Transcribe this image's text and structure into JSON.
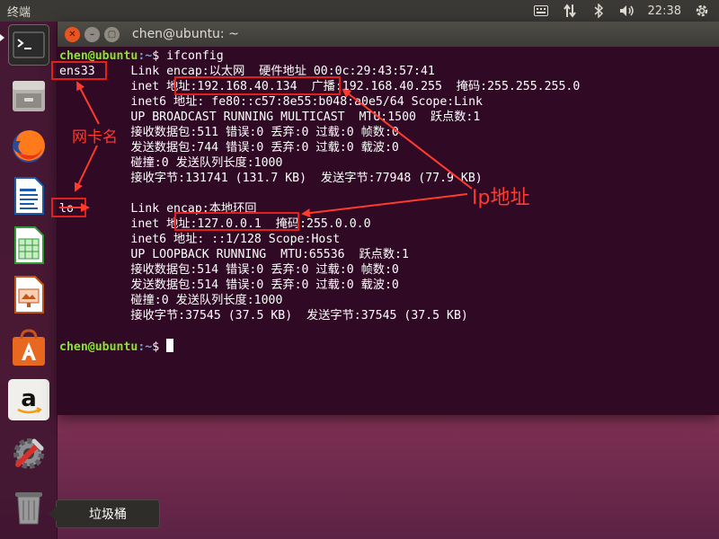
{
  "top_panel": {
    "app_title": "终端",
    "clock": "22:38",
    "tray_icons": [
      "keyboard-icon",
      "network-icon",
      "bluetooth-icon",
      "volume-icon",
      "gear-icon"
    ]
  },
  "launcher": {
    "items": [
      {
        "name": "terminal",
        "icon": "terminal-icon"
      },
      {
        "name": "files",
        "icon": "files-icon"
      },
      {
        "name": "firefox",
        "icon": "firefox-icon"
      },
      {
        "name": "writer",
        "icon": "writer-icon"
      },
      {
        "name": "calc",
        "icon": "calc-icon"
      },
      {
        "name": "impress",
        "icon": "impress-icon"
      },
      {
        "name": "software",
        "icon": "software-icon"
      },
      {
        "name": "amazon",
        "icon": "amazon-icon"
      },
      {
        "name": "settings",
        "icon": "settings-icon"
      },
      {
        "name": "trash",
        "icon": "trash-icon"
      }
    ],
    "tooltip": "垃圾桶"
  },
  "terminal": {
    "title": "chen@ubuntu: ~",
    "prompt_user": "chen@ubuntu",
    "prompt_path": ":~",
    "prompt_symbol": "$ ",
    "command": "ifconfig",
    "lines": [
      "ens33     Link encap:以太网  硬件地址 00:0c:29:43:57:41  ",
      "          inet 地址:192.168.40.134  广播:192.168.40.255  掩码:255.255.255.0",
      "          inet6 地址: fe80::c57:8e55:b048:a0e5/64 Scope:Link",
      "          UP BROADCAST RUNNING MULTICAST  MTU:1500  跃点数:1",
      "          接收数据包:511 错误:0 丢弃:0 过载:0 帧数:0",
      "          发送数据包:744 错误:0 丢弃:0 过载:0 载波:0",
      "          碰撞:0 发送队列长度:1000 ",
      "          接收字节:131741 (131.7 KB)  发送字节:77948 (77.9 KB)",
      "",
      "lo        Link encap:本地环回  ",
      "          inet 地址:127.0.0.1  掩码:255.0.0.0",
      "          inet6 地址: ::1/128 Scope:Host",
      "          UP LOOPBACK RUNNING  MTU:65536  跃点数:1",
      "          接收数据包:514 错误:0 丢弃:0 过载:0 帧数:0",
      "          发送数据包:514 错误:0 丢弃:0 过载:0 载波:0",
      "          碰撞:0 发送队列长度:1000 ",
      "          接收字节:37545 (37.5 KB)  发送字节:37545 (37.5 KB)",
      ""
    ]
  },
  "annotations": {
    "nic_label": "网卡名",
    "ip_label": "Ip地址",
    "color": "#ff3a2e"
  }
}
